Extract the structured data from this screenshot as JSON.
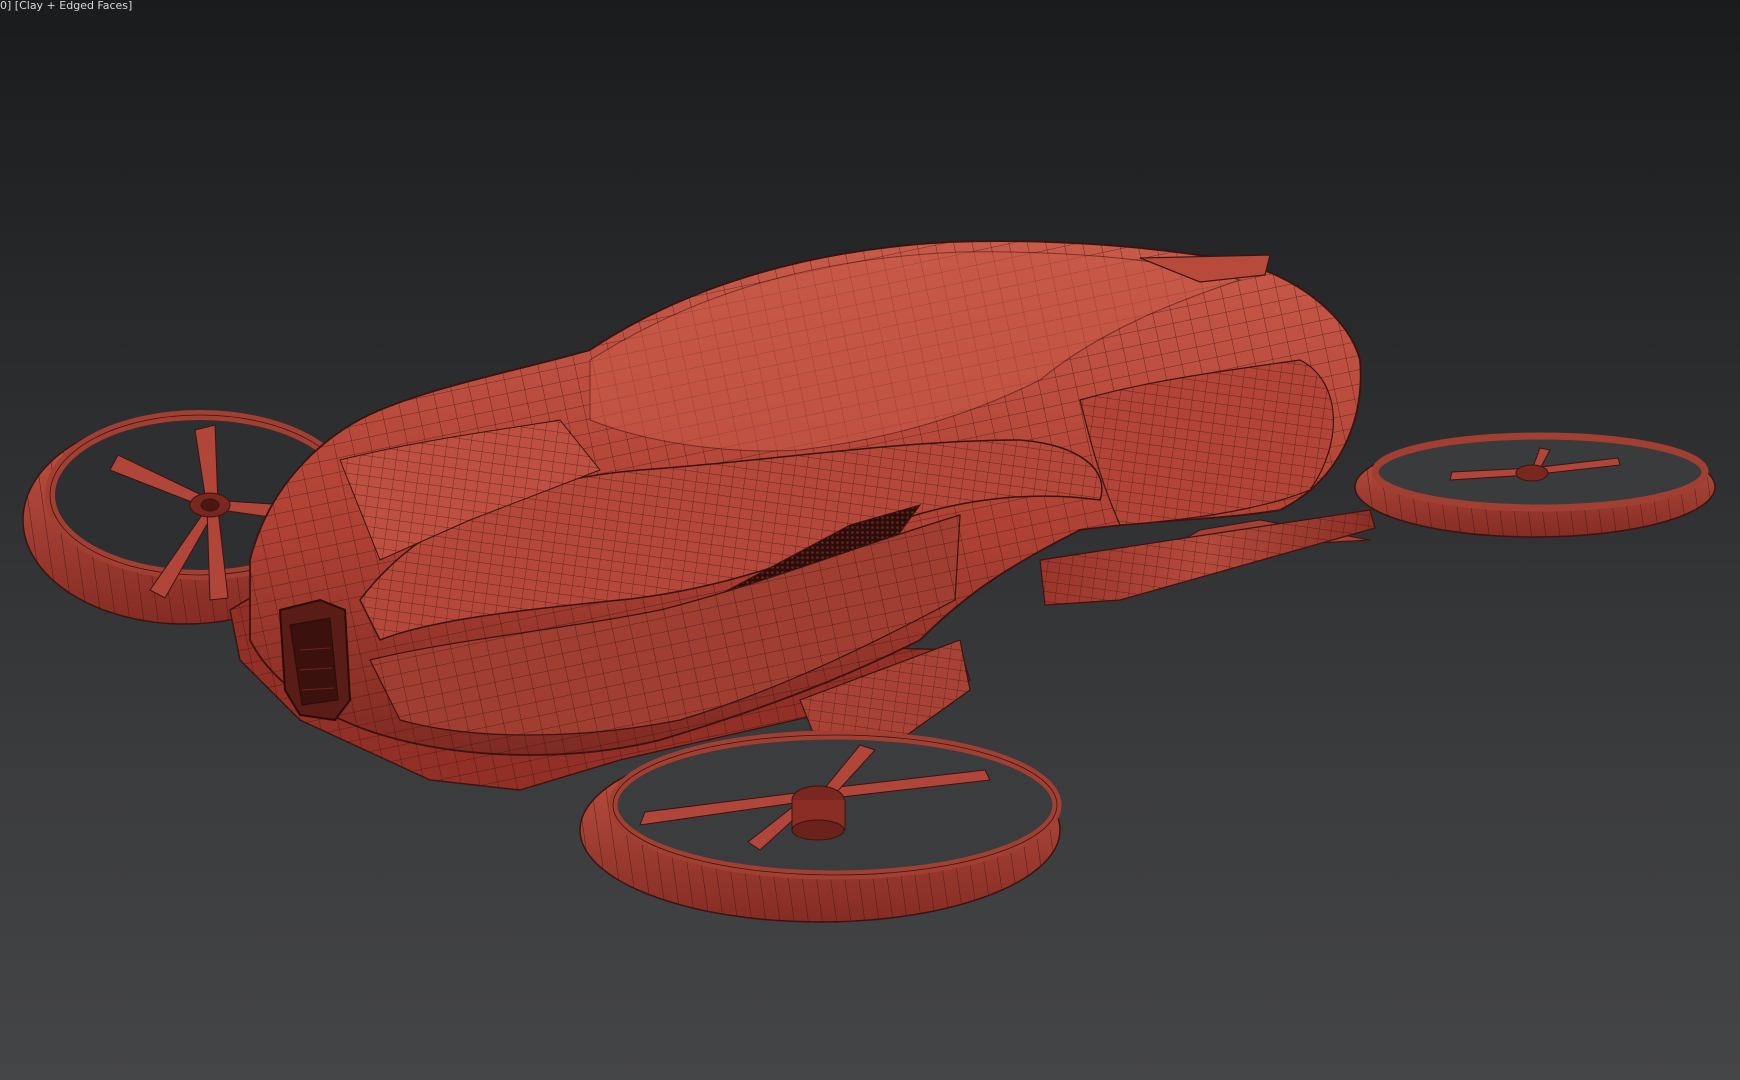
{
  "viewport": {
    "label_prefix": "0] [",
    "shading_mode": "Clay + Edged Faces",
    "label_suffix": "]"
  },
  "model": {
    "name": "flying-car-model",
    "clay_color": "#b8473a",
    "edge_color": "#3a1410"
  },
  "colors": {
    "background_top": "#1a1b1d",
    "background_bottom": "#444547"
  }
}
